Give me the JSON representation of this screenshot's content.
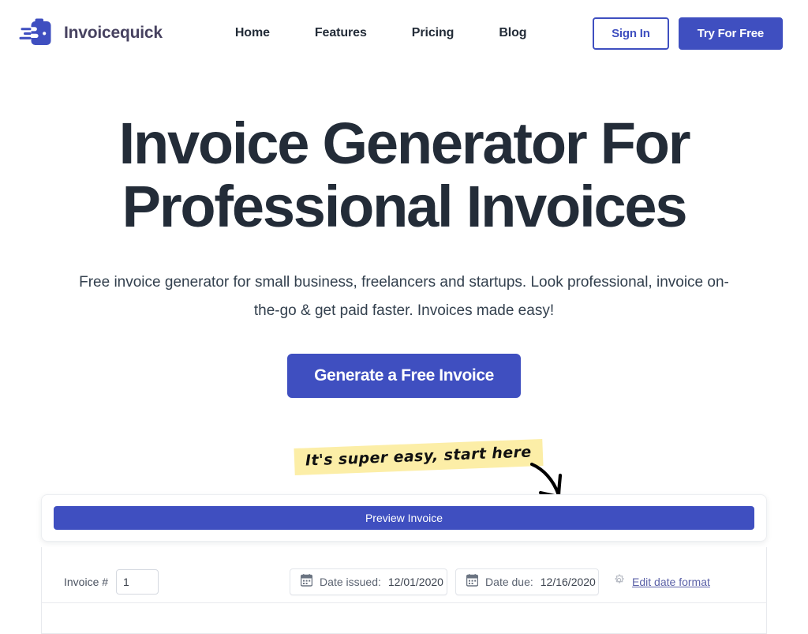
{
  "brand": {
    "name": "Invoicequick",
    "logo_icon": "briefcase-speed-icon",
    "logo_color": "#3f4fc0",
    "wordmark_color": "#474260"
  },
  "nav": {
    "items": [
      {
        "label": "Home"
      },
      {
        "label": "Features"
      },
      {
        "label": "Pricing"
      },
      {
        "label": "Blog"
      }
    ],
    "sign_in_label": "Sign In",
    "try_free_label": "Try For Free"
  },
  "hero": {
    "title_line1": "Invoice Generator For",
    "title_line2": "Professional Invoices",
    "subtitle_line1": "Free invoice generator for small business, freelancers and startups. Look professional,",
    "subtitle_line2": "invoice on-the-go & get paid faster. Invoices made easy!",
    "cta_label": "Generate a Free Invoice",
    "accent_color": "#3f4fc0",
    "title_color": "#232c38"
  },
  "annotation": {
    "note_text": "It's super easy, start here",
    "highlight_color": "#fceea7",
    "arrow_icon": "curved-down-right-arrow-icon"
  },
  "invoice_form": {
    "preview_label": "Preview Invoice",
    "invoice_number_label": "Invoice #",
    "invoice_number_value": "1",
    "date_issued": {
      "icon": "calendar-icon",
      "label": "Date issued:",
      "value": "12/01/2020"
    },
    "date_due": {
      "icon": "calendar-icon",
      "label": "Date due:",
      "value": "12/16/2020"
    },
    "edit_date_format": {
      "icon": "gear-icon",
      "label": "Edit date format"
    }
  }
}
